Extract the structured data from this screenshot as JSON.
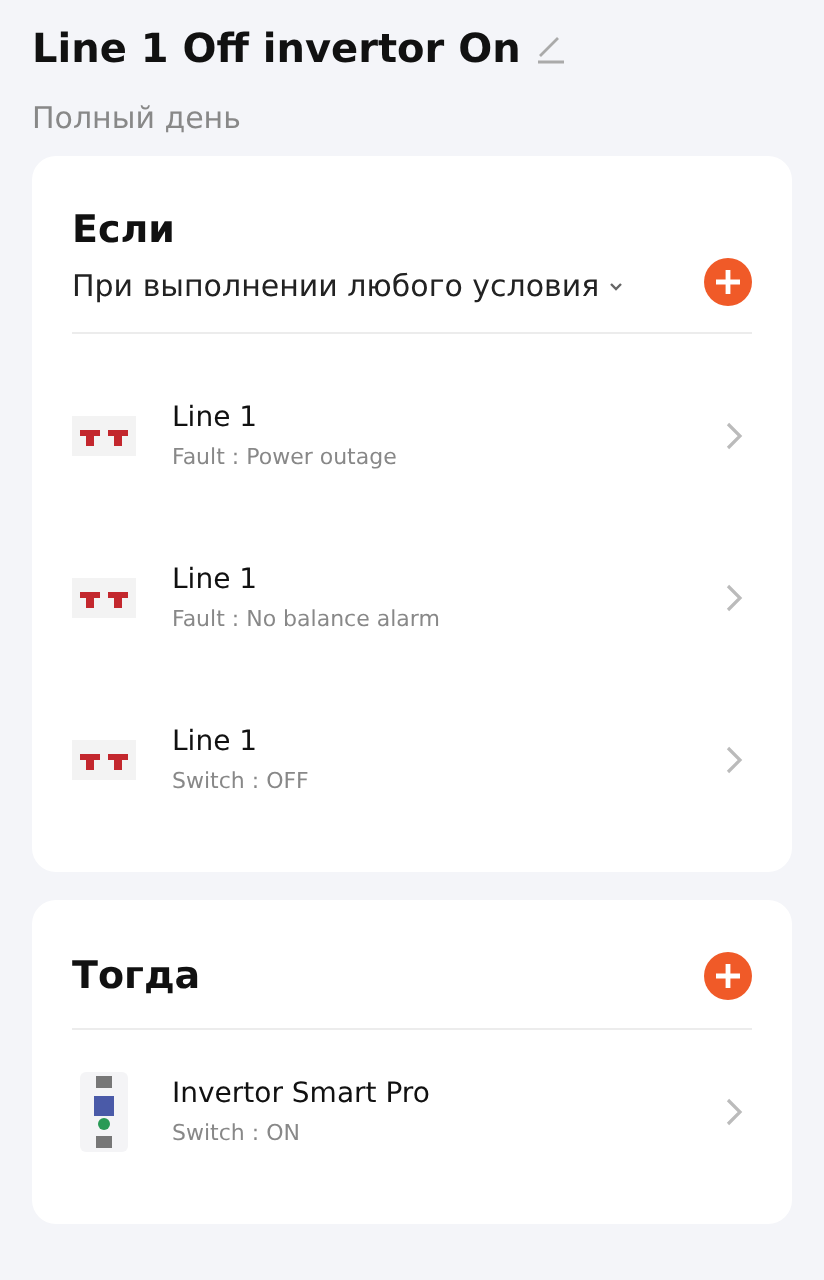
{
  "title": "Line 1 Off invertor On",
  "schedule": "Полный день",
  "conditions": {
    "heading": "Если",
    "mode": "При выполнении любого условия",
    "items": [
      {
        "kind": "breaker",
        "name": "Line 1",
        "detail": "Fault : Power outage"
      },
      {
        "kind": "breaker",
        "name": "Line 1",
        "detail": "Fault : No balance alarm"
      },
      {
        "kind": "breaker",
        "name": "Line 1",
        "detail": "Switch : OFF"
      }
    ]
  },
  "actions": {
    "heading": "Тогда",
    "items": [
      {
        "kind": "inverter",
        "name": "Invertor Smart Pro",
        "detail": "Switch : ON"
      }
    ]
  }
}
